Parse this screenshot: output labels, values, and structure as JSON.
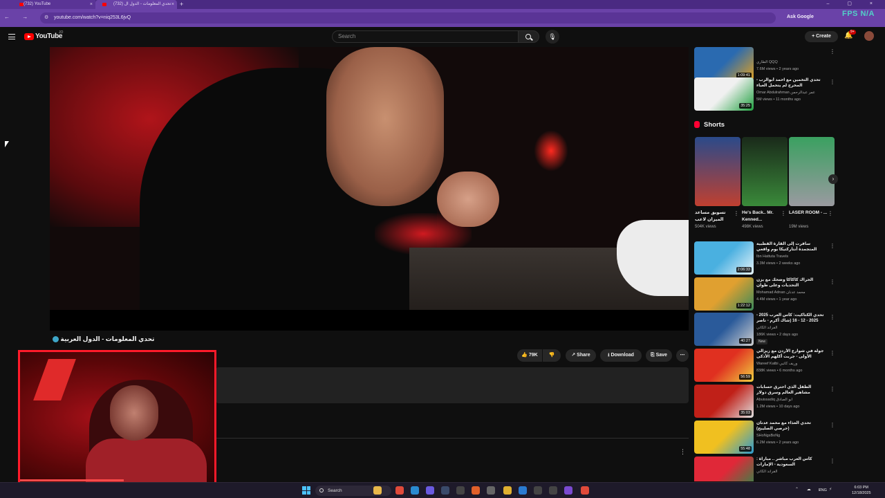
{
  "browser": {
    "tabs": [
      {
        "label": "(732) YouTube",
        "close": "×"
      },
      {
        "label": "(732) تحدي المعلومات - الدول ال",
        "close": "×"
      }
    ],
    "new_tab": "+",
    "window_controls": "– ▢ ×",
    "nav_buttons": "← → ⟳",
    "url": "youtube.com/watch?v=niq253L6jvQ",
    "ask_google": "Ask Google",
    "fps_overlay": "FPS N/A"
  },
  "youtube_header": {
    "logo_text": "YouTube",
    "country_code": "JO",
    "search_placeholder": "Search",
    "create_label": "+ Create",
    "notification_count": "9+"
  },
  "video": {
    "title": "تحدي المعلومات - الدول العربية",
    "actions": {
      "like_label": "👍 79K",
      "dislike_label": "👎",
      "share_label": "↗ Share",
      "download_label": "⭳ Download",
      "save_label": "⎘ Save",
      "more_label": "⋯"
    }
  },
  "sidebar_top": [
    {
      "title": "",
      "channel": "الطاري QQQ",
      "meta": "7.6M views • 2 years ago",
      "duration": "1:09:41",
      "colors": [
        "#2a6ab0",
        "#e0a020"
      ]
    },
    {
      "title": "تحدي التخمين مع احمد أبوالرب - المخرج لم يتحمل الغباء",
      "channel": "Omar Abdulrahman عمر عبدالرحمن",
      "meta": "5M views • 11 months ago",
      "duration": "35:25",
      "colors": [
        "#f0f0f0",
        "#20a040"
      ]
    }
  ],
  "shorts": {
    "heading": "Shorts",
    "items": [
      {
        "title": "تسويق مساعد الميزان لاعب",
        "views": "504K views",
        "colors": [
          "#2a4a8a",
          "#c04030"
        ]
      },
      {
        "title": "He's Back.. Mr. Kenned...",
        "views": "498K views",
        "colors": [
          "#1a2a1a",
          "#3a8a3a"
        ]
      },
      {
        "title": "LASER ROOM - ...",
        "views": "19M views",
        "colors": [
          "#3aa060",
          "#9a9aa0"
        ]
      }
    ],
    "next_label": "›"
  },
  "sidebar_list": [
    {
      "title": "سافرت إلى القارة القطبية المتجمدة أنتاركتيكا يوم واقعي التجربة كاملة",
      "channel": "Ibn Hattuta Travels",
      "meta": "3.3M views • 2 weeks ago",
      "duration": "2:06:33",
      "badge": "",
      "colors": [
        "#4ab0e0",
        "#e8f4fa"
      ]
    },
    {
      "title": "الحراك كاكاكا وضحك مع يزن التحديات وعلى طوان",
      "channel": "Mohamad Adnan محمد عدنان",
      "meta": "4.4M views • 1 year ago",
      "duration": "1:22:12",
      "badge": "",
      "colors": [
        "#e0a030",
        "#3a8a5a"
      ]
    },
    {
      "title": "تحدي الكتاكيت: كأس العرب 2025 - 2025 - 12 - 16 (شاك أكرم - ناصر الشمري)",
      "channel": "الفراند الكاتي",
      "meta": "186K views • 2 days ago",
      "duration": "40:27",
      "badge": "New",
      "colors": [
        "#2a5a9a",
        "#d0d0d0"
      ]
    },
    {
      "title": "جولة في شوارع الأردن مع زيزالي الأولى - جربت أكلهم الأذكى",
      "channel": "Wareef Katbi وريف كاتبي",
      "meta": "838K views • 6 months ago",
      "duration": "56:59",
      "badge": "",
      "colors": [
        "#e03020",
        "#f0d040"
      ]
    },
    {
      "title": "الطفل الذي احترق حسابات مشاهير العالم وسرق دولار مساعية",
      "channel": "Abuissadiq ابو الصادق",
      "meta": "1.2M views • 10 days ago",
      "duration": "35:03",
      "badge": "",
      "colors": [
        "#c02018",
        "#e0e0e0"
      ]
    },
    {
      "title": "تحدي الغذاء مع محمد عدنان (حرصي الصليبح)",
      "channel": "SHoNgsBoNg",
      "meta": "6.2M views • 2 years ago",
      "duration": "55:48",
      "badge": "",
      "colors": [
        "#f0c020",
        "#2a9ad0"
      ]
    },
    {
      "title": "كأس العرب مباشر .. مباراة : السعودية - الإمارات",
      "channel": "الفراند الكاتي",
      "meta": "",
      "duration": "",
      "badge": "",
      "colors": [
        "#e02838",
        "#2a8a4a"
      ]
    }
  ],
  "row_more": "⋮",
  "taskbar": {
    "search_label": "Search",
    "lang": "ENG",
    "time": "6:03 PM",
    "date": "12/18/2025",
    "tray_icons": "⌃ ☁ ♪ ⚡"
  },
  "theme": {
    "browser_tab": "#4a2a82",
    "browser_bar": "#6a42a8",
    "youtube_red": "#ff0000",
    "webcam_border": "#ff1a2a"
  }
}
